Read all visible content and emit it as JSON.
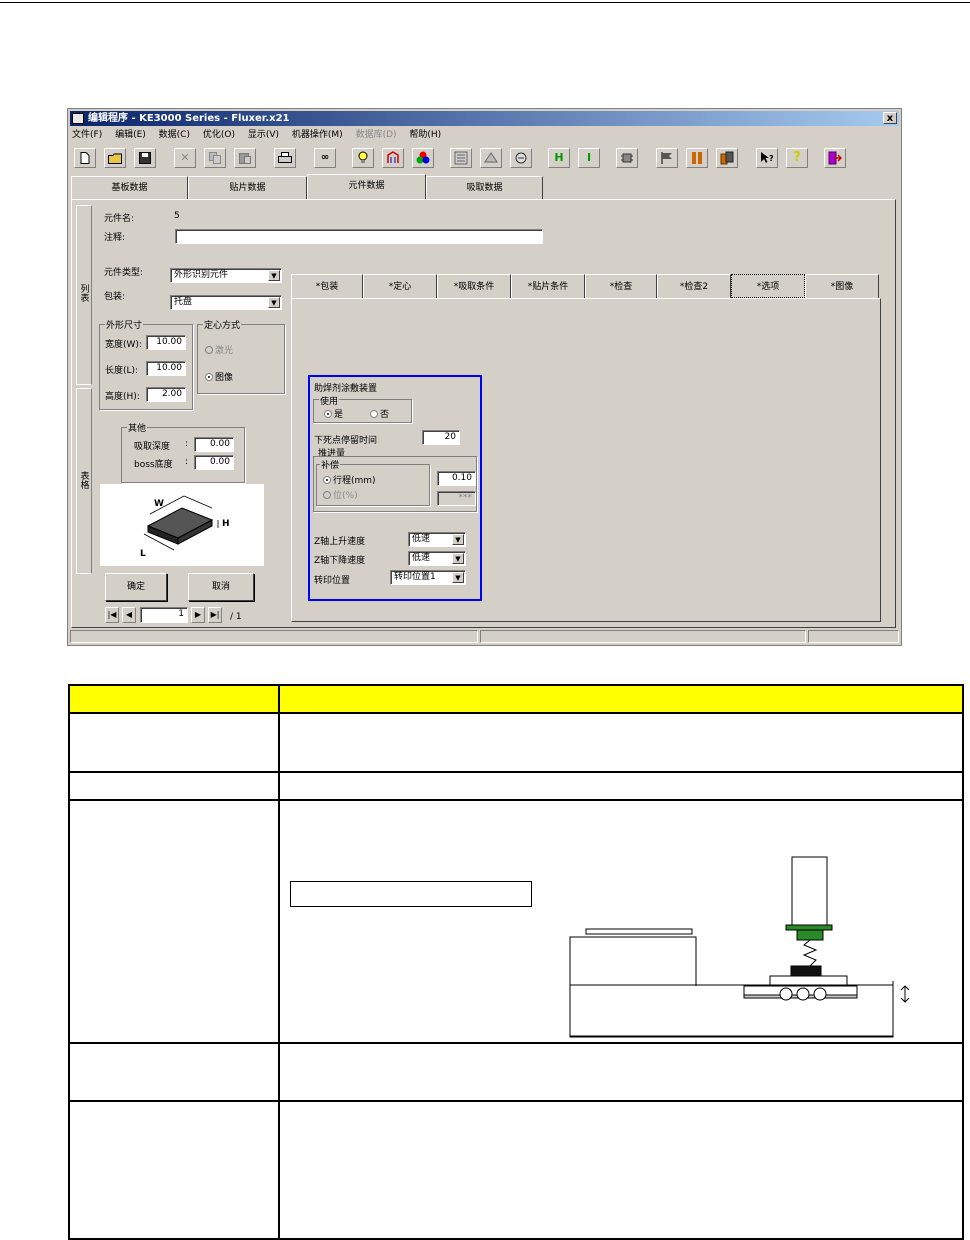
{
  "window": {
    "title": "编辑程序 - KE3000 Series - Fluxer.x21",
    "close_label": "x",
    "menus": [
      "文件(F)",
      "编辑(E)",
      "数据(C)",
      "优化(O)",
      "显示(V)",
      "机器操作(M)",
      "数据库(D)",
      "帮助(H)"
    ],
    "toolbar_icons": [
      "new-file-icon",
      "open-folder-icon",
      "save-icon",
      "cut-icon",
      "copy-icon",
      "paste-icon",
      "print-icon",
      "infinity-icon",
      "lightbulb-icon",
      "nozzle-icon",
      "rgb-icon",
      "board-icon",
      "feeder-icon",
      "head-icon",
      "align-h-icon",
      "align-i-icon",
      "component-icon",
      "flag-icon",
      "column-icon",
      "stack-icon",
      "help-cursor-icon",
      "question-icon",
      "exit-icon"
    ],
    "main_tabs": [
      "基板数据",
      "贴片数据",
      "元件数据",
      "吸取数据"
    ],
    "side_tabs": [
      "列表",
      "表格"
    ],
    "component": {
      "name_label": "元件名:",
      "name_value": "5",
      "comment_label": "注释:",
      "comment_value": "",
      "type_label": "元件类型:",
      "type_value": "外形识别元件",
      "package_label": "包装:",
      "package_value": "托盘"
    },
    "dimensions": {
      "title": "外形尺寸",
      "width_label": "宽度(W):",
      "width_value": "10.00",
      "length_label": "长度(L):",
      "length_value": "10.00",
      "height_label": "高度(H):",
      "height_value": "2.00"
    },
    "centering": {
      "title": "定心方式",
      "option_laser": "激光",
      "option_image": "图像"
    },
    "other": {
      "title": "其他",
      "pick_depth_label": "吸取深度",
      "pick_depth_value": "0.00",
      "boss_label": "boss底度",
      "boss_value": "0.00"
    },
    "buttons": {
      "ok": "确定",
      "cancel": "取消"
    },
    "pager": {
      "page": "1",
      "total": "/ 1"
    },
    "sub_tabs": [
      "*包装",
      "*定心",
      "*吸取条件",
      "*贴片条件",
      "*检查",
      "*检查2",
      "*选项",
      "*图像"
    ],
    "options": {
      "title": "助焊剂涂敷装置",
      "use_title": "使用",
      "use_yes": "是",
      "use_no": "否",
      "dwell_label": "下死点停留时间",
      "dwell_value": "20",
      "push_title": "推进量",
      "comp_title": "补偿",
      "stroke_label": "行程(mm)",
      "stroke_value": "0.10",
      "bit_label": "位(%)",
      "bit_value": "***",
      "z_up_label": "Z轴上升速度",
      "z_up_value": "低速",
      "z_down_label": "Z轴下降速度",
      "z_down_value": "低速",
      "transfer_label": "转印位置",
      "transfer_value": "转印位置1"
    },
    "chip_dims": {
      "w": "W",
      "l": "L",
      "h": "H"
    }
  },
  "colors": {
    "highlight_box": "#0000ff",
    "table_header": "#ffff00",
    "nozzle_green": "#2a8a2a"
  }
}
